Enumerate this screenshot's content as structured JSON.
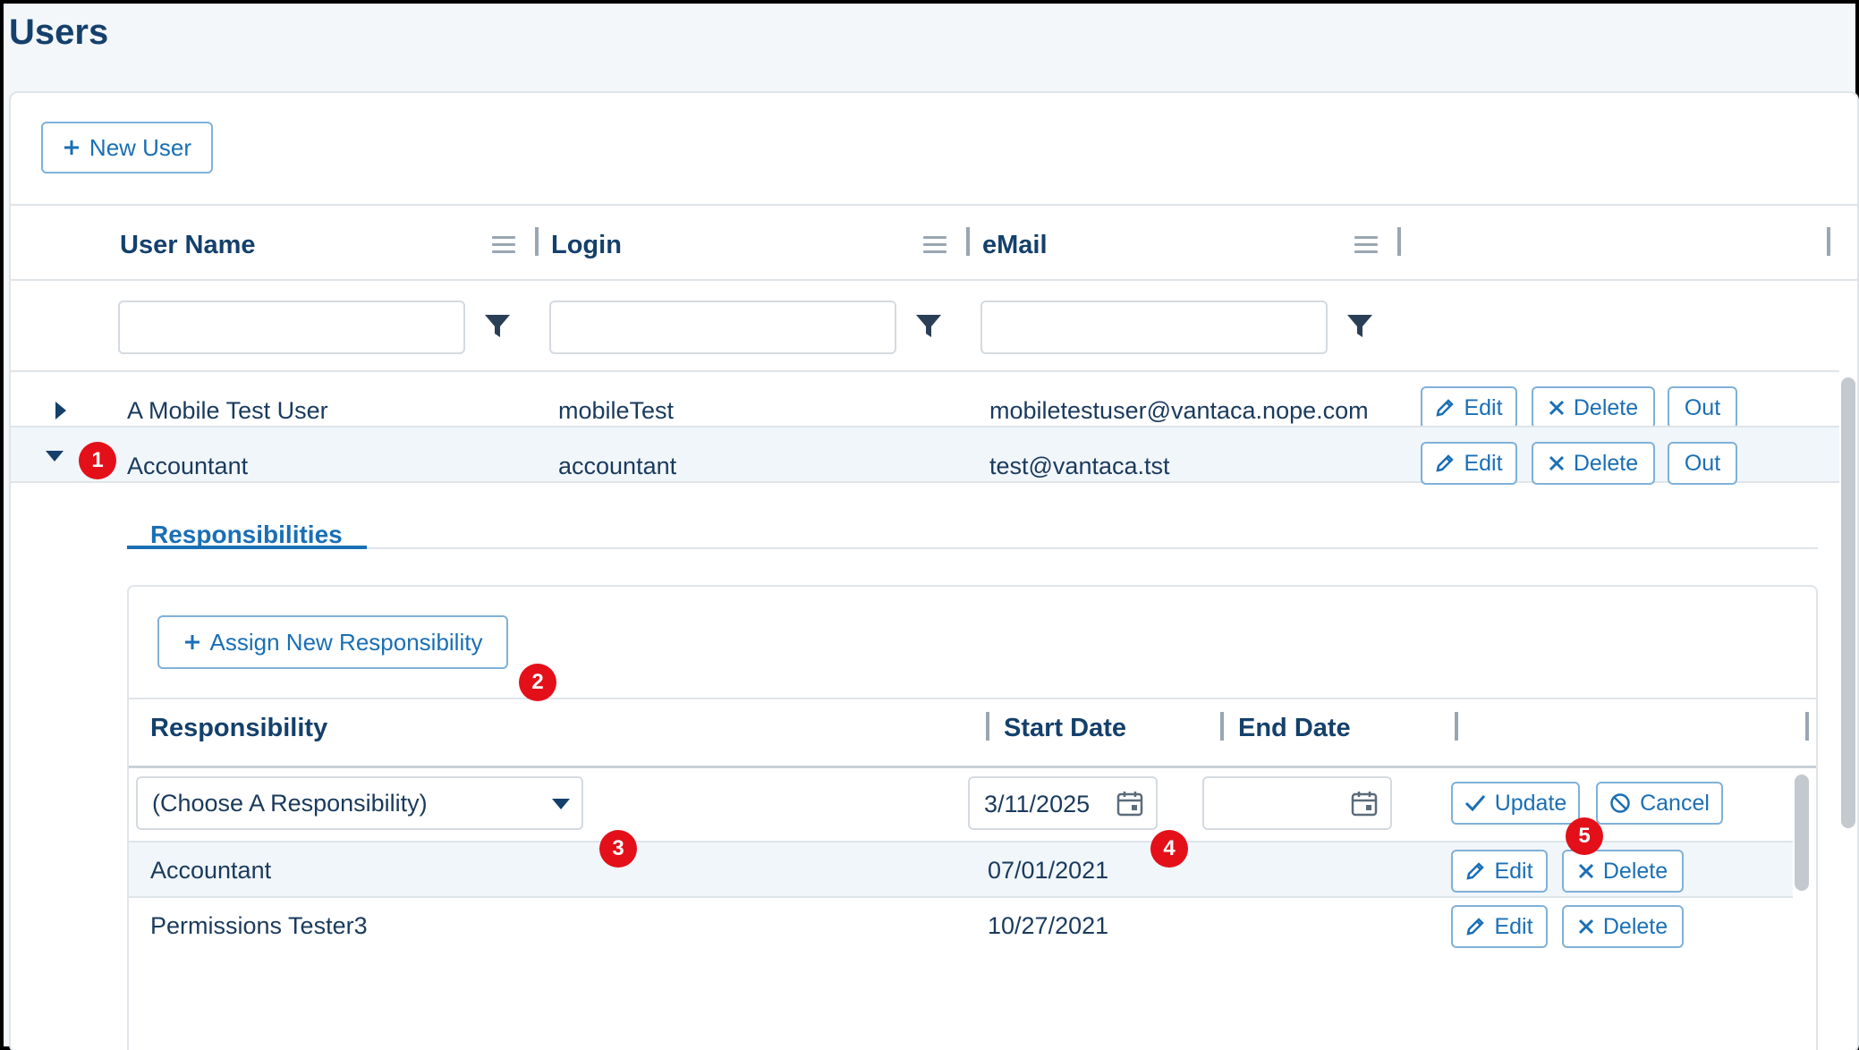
{
  "page": {
    "title": "Users"
  },
  "toolbar": {
    "new_user_label": "New User"
  },
  "users_grid": {
    "columns": [
      {
        "label": "User Name"
      },
      {
        "label": "Login"
      },
      {
        "label": "eMail"
      }
    ],
    "rows": [
      {
        "user_name": "A Mobile Test User",
        "login": "mobileTest",
        "email": "mobiletestuser@vantaca.nope.com",
        "expanded": false
      },
      {
        "user_name": "Accountant",
        "login": "accountant",
        "email": "test@vantaca.tst",
        "expanded": true
      }
    ],
    "row_actions": {
      "edit": "Edit",
      "delete": "Delete",
      "out": "Out"
    }
  },
  "detail": {
    "tab_label": "Responsibilities",
    "assign_label": "Assign New Responsibility",
    "columns": [
      {
        "label": "Responsibility"
      },
      {
        "label": "Start Date"
      },
      {
        "label": "End Date"
      }
    ],
    "edit_row": {
      "responsibility_placeholder": "(Choose A Responsibility)",
      "start_date": "3/11/2025",
      "end_date": "",
      "update_label": "Update",
      "cancel_label": "Cancel"
    },
    "rows": [
      {
        "responsibility": "Accountant",
        "start_date": "07/01/2021",
        "end_date": ""
      },
      {
        "responsibility": "Permissions Tester3",
        "start_date": "10/27/2021",
        "end_date": ""
      }
    ],
    "row_actions": {
      "edit": "Edit",
      "delete": "Delete"
    }
  },
  "callouts": [
    "1",
    "2",
    "3",
    "4",
    "5"
  ],
  "colors": {
    "accent": "#1a6fb5",
    "heading": "#14406b",
    "badge": "#e3101a"
  }
}
